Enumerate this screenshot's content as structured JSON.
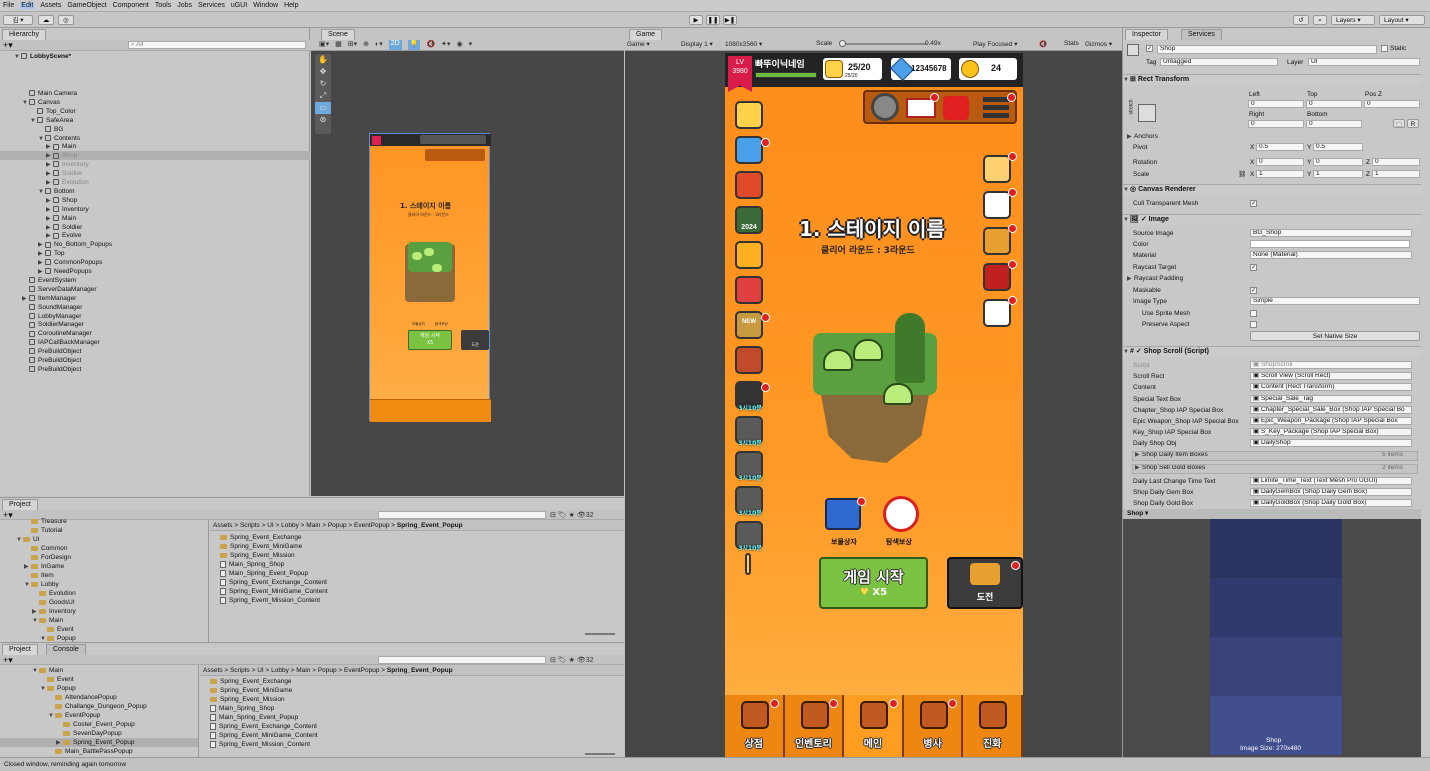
{
  "menu": {
    "items": [
      "File",
      "Edit",
      "Assets",
      "GameObject",
      "Component",
      "Tools",
      "Jobs",
      "Services",
      "uGUI",
      "Window",
      "Help"
    ],
    "account": "김",
    "layers": "Layers",
    "layout": "Layout"
  },
  "hierarchy": {
    "title": "Hierarchy",
    "search_placeholder": "All",
    "scene": "LobbyScene*",
    "rows": [
      {
        "t": "Main Camera",
        "d": 2,
        "a": ""
      },
      {
        "t": "Canvas",
        "d": 2,
        "a": "▼"
      },
      {
        "t": "Top_Color",
        "d": 3,
        "a": ""
      },
      {
        "t": "SafeArea",
        "d": 3,
        "a": "▼"
      },
      {
        "t": "BG",
        "d": 4,
        "a": ""
      },
      {
        "t": "Contents",
        "d": 4,
        "a": "▼"
      },
      {
        "t": "Main",
        "d": 5,
        "a": "▶"
      },
      {
        "t": "Shop",
        "d": 5,
        "a": "▶",
        "sel": true
      },
      {
        "t": "Inventory",
        "d": 5,
        "a": "▶",
        "dim": true
      },
      {
        "t": "Soldier",
        "d": 5,
        "a": "▶",
        "dim": true
      },
      {
        "t": "Evolution",
        "d": 5,
        "a": "▶",
        "dim": true
      },
      {
        "t": "Bottom",
        "d": 4,
        "a": "▼"
      },
      {
        "t": "Shop",
        "d": 5,
        "a": "▶"
      },
      {
        "t": "Inventory",
        "d": 5,
        "a": "▶"
      },
      {
        "t": "Main",
        "d": 5,
        "a": "▶"
      },
      {
        "t": "Soldier",
        "d": 5,
        "a": "▶"
      },
      {
        "t": "Evolve",
        "d": 5,
        "a": "▶"
      },
      {
        "t": "No_Bottom_Popups",
        "d": 4,
        "a": "▶"
      },
      {
        "t": "Top",
        "d": 4,
        "a": "▶"
      },
      {
        "t": "CommonPopups",
        "d": 4,
        "a": "▶"
      },
      {
        "t": "NeedPopups",
        "d": 4,
        "a": "▶"
      },
      {
        "t": "EventSystem",
        "d": 2,
        "a": ""
      },
      {
        "t": "ServerDataManager",
        "d": 2,
        "a": ""
      },
      {
        "t": "ItemManager",
        "d": 2,
        "a": "▶"
      },
      {
        "t": "SoundManager",
        "d": 2,
        "a": ""
      },
      {
        "t": "LobbyManager",
        "d": 2,
        "a": ""
      },
      {
        "t": "SoldierManager",
        "d": 2,
        "a": ""
      },
      {
        "t": "CoroutineManager",
        "d": 2,
        "a": ""
      },
      {
        "t": "IAPCallBackManager",
        "d": 2,
        "a": ""
      },
      {
        "t": "PreBuildObject",
        "d": 2,
        "a": ""
      },
      {
        "t": "PreBuildObject",
        "d": 2,
        "a": ""
      },
      {
        "t": "PreBuildObject",
        "d": 2,
        "a": ""
      }
    ]
  },
  "scene": {
    "title": "Scene",
    "mini_stage_title": "1. 스테이지 이름",
    "mini_round": "클리어 라운드 : 3라운드",
    "mini_start": "게임 시작",
    "mini_cost": "X5",
    "mini_challenge": "도전",
    "mini_chest": "보물상자",
    "mini_reward": "탐색보상"
  },
  "game": {
    "title": "Game",
    "display_mode": "Game",
    "display": "Display 1",
    "resolution": "1080x2560",
    "scale_label": "Scale",
    "scale_value": "0.49x",
    "play_focused": "Play Focused",
    "stats": "Stats",
    "gizmos": "Gizmos"
  },
  "hud": {
    "level_label": "LV",
    "level_value": "3980",
    "player_name": "빠뚜이닉네임",
    "stamina": "25/20",
    "stamina_sub": "25/20",
    "gems": "12345678",
    "coins": "24",
    "stage_title": "1. 스테이지 이름",
    "clear_round": "클리어 라운드 : 3라운드",
    "start_button": "게임 시작",
    "start_cost": "X5",
    "challenge_button": "도전",
    "chest_label": "보물상자",
    "explore_label": "탐색보상",
    "side_year": "2024",
    "side_timers": [
      "3시10분",
      "3시10분",
      "3시10분",
      "3시10분",
      "3시10분"
    ],
    "side_new": "NEW",
    "bottom_tabs": [
      "상점",
      "인벤토리",
      "메인",
      "병사",
      "진화"
    ],
    "colors": {
      "orange": "#ff9a1a",
      "green": "#7cc242",
      "dark": "#3b3b3b",
      "red": "#e02020"
    }
  },
  "inspector": {
    "title": "Inspector",
    "services": "Services",
    "object_name": "Shop",
    "static": "Static",
    "tag_label": "Tag",
    "tag_value": "Untagged",
    "layer_label": "Layer",
    "layer_value": "UI",
    "rect_transform": "Rect Transform",
    "stretch": "stretch",
    "left": "Left",
    "left_v": "0",
    "top": "Top",
    "top_v": "0",
    "posz": "Pos Z",
    "posz_v": "0",
    "right": "Right",
    "right_v": "0",
    "bottom": "Bottom",
    "bottom_v": "0",
    "anchors": "Anchors",
    "pivot": "Pivot",
    "pivot_x": "0.5",
    "pivot_y": "0.5",
    "rotation": "Rotation",
    "rot_x": "0",
    "rot_y": "0",
    "rot_z": "0",
    "scale": "Scale",
    "scale_x": "1",
    "scale_y": "1",
    "scale_z": "1",
    "canvas_renderer": "Canvas Renderer",
    "cull": "Cull Transparent Mesh",
    "image": "Image",
    "source_image": "Source Image",
    "source_image_v": "BG_Shop",
    "color": "Color",
    "material": "Material",
    "material_v": "None (Material)",
    "raycast_target": "Raycast Target",
    "raycast_padding": "Raycast Padding",
    "maskable": "Maskable",
    "image_type": "Image Type",
    "image_type_v": "Simple",
    "use_sprite_mesh": "Use Sprite Mesh",
    "preserve_aspect": "Preserve Aspect",
    "set_native": "Set Native Size",
    "shop_scroll": "Shop Scroll (Script)",
    "script_fields": [
      {
        "k": "Script",
        "v": "ShopScroll",
        "dim": true
      },
      {
        "k": "Scroll Rect",
        "v": "Scroll View (Scroll Rect)"
      },
      {
        "k": "Content",
        "v": "Content (Rect Transform)"
      },
      {
        "k": "Special Text Box",
        "v": "Special_Sale_Tag"
      },
      {
        "k": "Chapter_Shop IAP Special Box",
        "v": "Chapter_Special_Sale_Box (Shop IAP Special Bo"
      },
      {
        "k": "Epic Weapon_Shop IAP Special Box",
        "v": "Epic_Weapon_Package (Shop IAP Special Box"
      },
      {
        "k": "Key_Shop IAP Special Box",
        "v": "S_Key_Package (Shop IAP Special Box)"
      },
      {
        "k": "Daily Shop Obj",
        "v": "DailyShop"
      }
    ],
    "daily_items": "Shop Daily Item Boxes",
    "daily_items_count": "5 items",
    "sell_gold": "Shop Sell Gold Boxes",
    "sell_gold_count": "2 items",
    "script_fields2": [
      {
        "k": "Daily Last Change Time Text",
        "v": "Limite_Time_Text (Text Mesh Pro UGUI)"
      },
      {
        "k": "Shop Daily Gem Box",
        "v": "DailyGemBox (Shop Daily Gem Box)"
      },
      {
        "k": "Shop Daily Gold Box",
        "v": "DailyGoldBox (Shop Daily Gold Box)"
      }
    ],
    "preview_title": "Shop",
    "preview_name": "Shop",
    "preview_size": "Image Size: 270x480"
  },
  "project1": {
    "title": "Project",
    "count": "32",
    "tree": [
      {
        "t": "Treasure",
        "d": 2,
        "a": ""
      },
      {
        "t": "Tutorial",
        "d": 2,
        "a": ""
      },
      {
        "t": "UI",
        "d": 1,
        "a": "▼"
      },
      {
        "t": "Common",
        "d": 2,
        "a": ""
      },
      {
        "t": "ForDesign",
        "d": 2,
        "a": ""
      },
      {
        "t": "InGame",
        "d": 2,
        "a": "▶"
      },
      {
        "t": "Item",
        "d": 2,
        "a": ""
      },
      {
        "t": "Lobby",
        "d": 2,
        "a": "▼"
      },
      {
        "t": "Evolution",
        "d": 3,
        "a": ""
      },
      {
        "t": "GoodsUI",
        "d": 3,
        "a": ""
      },
      {
        "t": "Inventory",
        "d": 3,
        "a": "▶"
      },
      {
        "t": "Main",
        "d": 3,
        "a": "▼"
      },
      {
        "t": "Event",
        "d": 4,
        "a": ""
      },
      {
        "t": "Popup",
        "d": 4,
        "a": "▼"
      }
    ],
    "path": [
      "Assets",
      "Scripts",
      "UI",
      "Lobby",
      "Main",
      "Popup",
      "EventPopup",
      "Spring_Event_Popup"
    ],
    "files": [
      {
        "t": "Spring_Event_Exchange",
        "f": true
      },
      {
        "t": "Spring_Event_MiniGame",
        "f": true
      },
      {
        "t": "Spring_Event_Mission",
        "f": true
      },
      {
        "t": "Main_Spring_Shop",
        "f": false
      },
      {
        "t": "Main_Spring_Event_Popup",
        "f": false
      },
      {
        "t": "Spring_Event_Exchange_Content",
        "f": false
      },
      {
        "t": "Spring_Event_MiniGame_Content",
        "f": false
      },
      {
        "t": "Spring_Event_Mission_Content",
        "f": false
      }
    ]
  },
  "project2": {
    "title": "Project",
    "console": "Console",
    "count": "32",
    "tree": [
      {
        "t": "Main",
        "d": 3,
        "a": "▼"
      },
      {
        "t": "Event",
        "d": 4,
        "a": ""
      },
      {
        "t": "Popup",
        "d": 4,
        "a": "▼"
      },
      {
        "t": "AttendancePopup",
        "d": 5,
        "a": ""
      },
      {
        "t": "Challange_Dungeon_Popup",
        "d": 5,
        "a": ""
      },
      {
        "t": "EventPopup",
        "d": 5,
        "a": "▼"
      },
      {
        "t": "Coster_Event_Popup",
        "d": 6,
        "a": ""
      },
      {
        "t": "SevenDayPopup",
        "d": 6,
        "a": ""
      },
      {
        "t": "Spring_Event_Popup",
        "d": 6,
        "a": "▶",
        "sel": true
      },
      {
        "t": "Main_BattlePassPopup",
        "d": 5,
        "a": ""
      }
    ],
    "path": [
      "Assets",
      "Scripts",
      "UI",
      "Lobby",
      "Main",
      "Popup",
      "EventPopup",
      "Spring_Event_Popup"
    ],
    "files": [
      {
        "t": "Spring_Event_Exchange",
        "f": true
      },
      {
        "t": "Spring_Event_MiniGame",
        "f": true
      },
      {
        "t": "Spring_Event_Mission",
        "f": true
      },
      {
        "t": "Main_Spring_Shop",
        "f": false
      },
      {
        "t": "Main_Spring_Event_Popup",
        "f": false
      },
      {
        "t": "Spring_Event_Exchange_Content",
        "f": false
      },
      {
        "t": "Spring_Event_MiniGame_Content",
        "f": false
      },
      {
        "t": "Spring_Event_Mission_Content",
        "f": false
      }
    ]
  },
  "status": {
    "message": "Closed window, reminding again tomorrow"
  }
}
